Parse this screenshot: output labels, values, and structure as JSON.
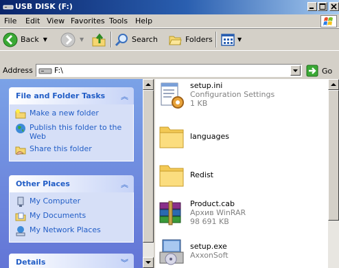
{
  "window": {
    "title": "USB DISK (F:)"
  },
  "menu": [
    "File",
    "Edit",
    "View",
    "Favorites",
    "Tools",
    "Help"
  ],
  "toolbar": {
    "back_label": "Back",
    "search_label": "Search",
    "folders_label": "Folders"
  },
  "address": {
    "label": "Address",
    "value": "F:\\",
    "go_label": "Go"
  },
  "tasks_panel": {
    "title": "File and Folder Tasks",
    "items": [
      "Make a new folder",
      "Publish this folder to the Web",
      "Share this folder"
    ]
  },
  "places_panel": {
    "title": "Other Places",
    "items": [
      "My Computer",
      "My Documents",
      "My Network Places"
    ]
  },
  "details_panel": {
    "title": "Details"
  },
  "files": [
    {
      "name": "setup.ini",
      "line2": "Configuration Settings",
      "line3": "1 KB",
      "icon": "ini-file-icon"
    },
    {
      "name": "languages",
      "line2": "",
      "line3": "",
      "icon": "folder-icon"
    },
    {
      "name": "Redist",
      "line2": "",
      "line3": "",
      "icon": "folder-icon"
    },
    {
      "name": "Product.cab",
      "line2": "Архив WinRAR",
      "line3": "98 691 KB",
      "icon": "winrar-archive-icon"
    },
    {
      "name": "setup.exe",
      "line2": "AxxonSoft",
      "line3": "",
      "icon": "setup-exe-icon"
    }
  ],
  "colors": {
    "title_gradient_start": "#0a246a",
    "task_pane_bg": "#7ba2e7",
    "link_blue": "#215dc6"
  }
}
